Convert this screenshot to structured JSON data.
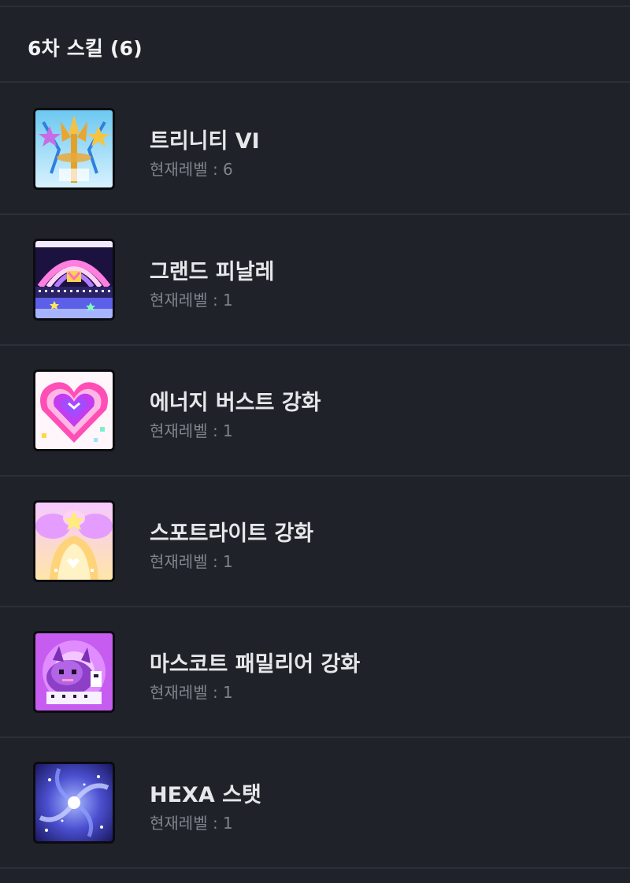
{
  "section": {
    "title": "6차 스킬 (6)"
  },
  "skills": [
    {
      "name": "트리니티 VI",
      "level_text": "현재레벨 : 6",
      "icon": "trinity-trident-icon"
    },
    {
      "name": "그랜드 피날레",
      "level_text": "현재레벨 : 1",
      "icon": "grand-finale-stage-icon"
    },
    {
      "name": "에너지 버스트 강화",
      "level_text": "현재레벨 : 1",
      "icon": "energy-burst-heart-icon"
    },
    {
      "name": "스포트라이트 강화",
      "level_text": "현재레벨 : 1",
      "icon": "spotlight-angel-icon"
    },
    {
      "name": "마스코트 패밀리어 강화",
      "level_text": "현재레벨 : 1",
      "icon": "mascot-familiar-icon"
    },
    {
      "name": "HEXA 스탯",
      "level_text": "현재레벨 : 1",
      "icon": "hexa-stat-galaxy-icon"
    }
  ]
}
